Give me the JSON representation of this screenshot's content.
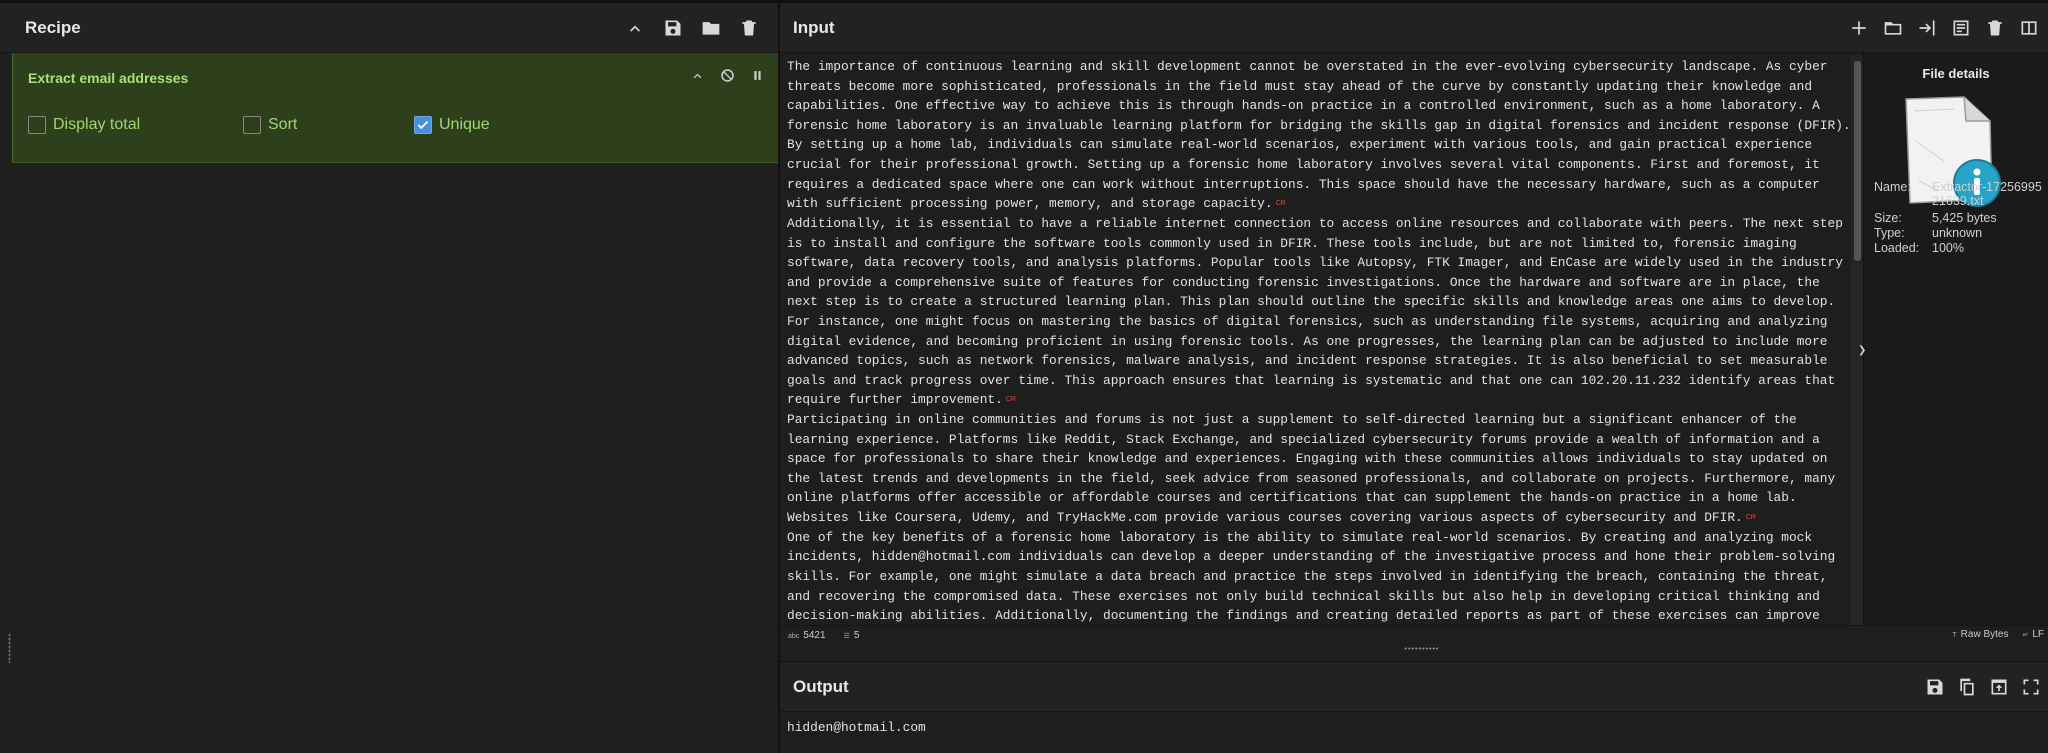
{
  "recipe": {
    "title": "Recipe",
    "operation": {
      "name": "Extract email addresses",
      "options": [
        {
          "label": "Display total",
          "checked": false
        },
        {
          "label": "Sort",
          "checked": false
        },
        {
          "label": "Unique",
          "checked": true
        }
      ]
    },
    "icons": [
      "chevron-up-icon",
      "save-icon",
      "folder-icon",
      "trash-icon"
    ]
  },
  "input": {
    "title": "Input",
    "paragraphs": [
      "The importance of continuous learning and skill development cannot be overstated in the ever-evolving cybersecurity landscape. As cyber threats become more sophisticated, professionals in the field must stay ahead of the curve by constantly updating their knowledge and capabilities. One effective way to achieve this is through hands-on practice in a controlled environment, such as a home laboratory. A forensic home laboratory is an invaluable learning platform for bridging the skills gap in digital forensics and incident response (DFIR). By setting up a home lab, individuals can simulate real-world scenarios, experiment with various tools, and gain practical experience crucial for their professional growth. Setting up a forensic home laboratory involves several vital components. First and foremost, it requires a dedicated space where one can work without interruptions. This space should have the necessary hardware, such as a computer with sufficient processing power, memory, and storage capacity.",
      "Additionally, it is essential to have a reliable internet connection to access online resources and collaborate with peers. The next step is to install and configure the software tools commonly used in DFIR. These tools include, but are not limited to, forensic imaging software, data recovery tools, and analysis platforms. Popular tools like Autopsy, FTK Imager, and EnCase are widely used in the industry and provide a comprehensive suite of features for conducting forensic investigations. Once the hardware and software are in place, the next step is to create a structured learning plan. This plan should outline the specific skills and knowledge areas one aims to develop. For instance, one might focus on mastering the basics of digital forensics, such as understanding file systems, acquiring and analyzing digital evidence, and becoming proficient in using forensic tools. As one progresses, the learning plan can be adjusted to include more advanced topics, such as network forensics, malware analysis, and incident response strategies. It is also beneficial to set measurable goals and track progress over time. This approach ensures that learning is systematic and that one can 102.20.11.232 identify areas that require further improvement.",
      "Participating in online communities and forums is not just a supplement to self-directed learning but a significant enhancer of the learning experience. Platforms like Reddit, Stack Exchange, and specialized cybersecurity forums provide a wealth of information and a space for professionals to share their knowledge and experiences. Engaging with these communities allows individuals to stay updated on the latest trends and developments in the field, seek advice from seasoned professionals, and collaborate on projects. Furthermore, many online platforms offer accessible or affordable courses and certifications that can supplement the hands-on practice in a home lab. Websites like Coursera, Udemy, and TryHackMe.com provide various courses covering various aspects of cybersecurity and DFIR.",
      "One of the key benefits of a forensic home laboratory is the ability to simulate real-world scenarios. By creating and analyzing mock incidents, hidden@hotmail.com individuals can develop a deeper understanding of the investigative process and hone their problem-solving skills. For example, one might simulate a data breach and practice the steps involved in identifying the breach, containing the threat, and recovering the compromised data. These exercises not only build technical skills but also help in developing critical thinking and decision-making abilities. Additionally, documenting the findings and creating detailed reports as part of these exercises can improve"
    ],
    "line_break_marker": "CR",
    "file_details": {
      "title": "File details",
      "name_label": "Name:",
      "name": "Extractor-1725699521639.txt",
      "size_label": "Size:",
      "size": "5,425 bytes",
      "type_label": "Type:",
      "type": "unknown",
      "loaded_label": "Loaded:",
      "loaded": "100%"
    },
    "status": {
      "chars_icon": "abc",
      "chars": "5421",
      "lines": "5",
      "raw_bytes": "Raw Bytes",
      "line_ending": "LF"
    }
  },
  "output": {
    "title": "Output",
    "text": "hidden@hotmail.com"
  },
  "colors": {
    "operation_bg": "#2d3f1b",
    "operation_text": "#a8e07a",
    "checkbox_checked": "#4a8fd8",
    "cr_marker": "#e04a3a"
  }
}
